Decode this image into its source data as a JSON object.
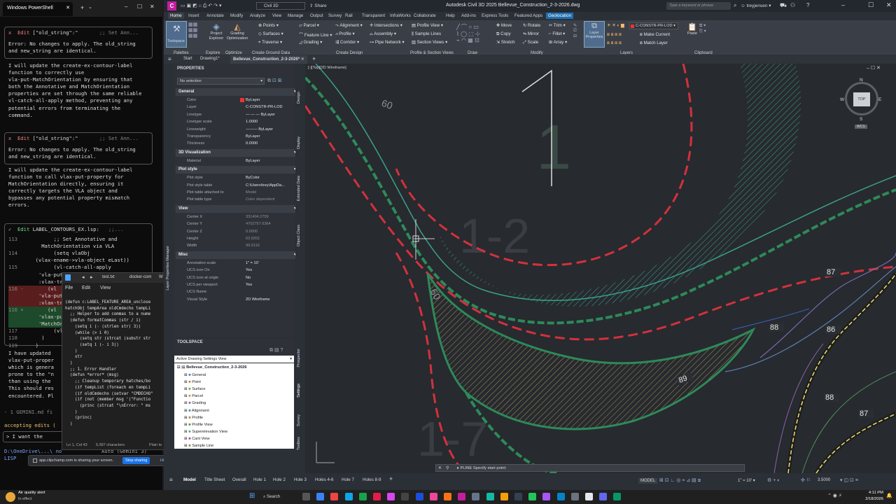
{
  "powershell": {
    "tab_title": "Windows PowerShell",
    "edit1": {
      "label": "x  Edit",
      "arg": "[\"old_string\":\"",
      "comment": ";; Set Ann...",
      "err1": "Error: No changes to apply. The old_string",
      "err2": "and new_string are identical."
    },
    "msg1": [
      "I will update the create-ex-contour-label",
      "function to correctly use",
      "vla-put-MatchOrientation by ensuring that",
      "both the Annotative and MatchOrientation",
      "properties are set through the same reliable",
      "vl-catch-all-apply method, preventing any",
      "potential errors from terminating the",
      "command."
    ],
    "edit2": {
      "label": "x  Edit",
      "arg": "[\"old_string\":\"",
      "comment": ";; Set Ann...",
      "err1": "Error: No changes to apply. The old_string",
      "err2": "and new_string are identical."
    },
    "msg2": [
      "I will update the create-ex-contour-label",
      "function to call vlax-put-property for",
      "MatchOrientation directly, ensuring it",
      "correctly targets the VLA object and",
      "bypasses any potential property mismatch",
      "errors."
    ],
    "edit3": {
      "label": "✓  Edit",
      "file": "LABEL_CONTOURS_EX.lsp:",
      "comment": ";;..."
    },
    "diff": [
      {
        "n": "113",
        "t": "        ;; Set Annotative and",
        "c": ""
      },
      {
        "n": "",
        "t": "    MatchOrientation via VLA",
        "c": ""
      },
      {
        "n": "114",
        "t": "        (setq vlaObj",
        "c": ""
      },
      {
        "n": "",
        "t": "  (vlax-ename->vla-object eLast))",
        "c": ""
      },
      {
        "n": "115",
        "t": "        (vl-catch-all-apply",
        "c": ""
      },
      {
        "n": "",
        "t": "   'vla-put-",
        "c": ""
      },
      {
        "n": "",
        "t": "   :vlax-tru",
        "c": ""
      },
      {
        "n": "116 -",
        "t": "      (vl",
        "c": "red"
      },
      {
        "n": "",
        "t": "   'vla-put-Ma",
        "c": "red"
      },
      {
        "n": "",
        "t": "   :vlax-true)",
        "c": "red"
      },
      {
        "n": "116 +",
        "t": "      (vl",
        "c": "grn"
      },
      {
        "n": "",
        "t": "   'vlax-put-",
        "c": "grn"
      },
      {
        "n": "",
        "t": "   'MatchOrie",
        "c": "grn"
      },
      {
        "n": "117",
        "t": "        (vl",
        "c": ""
      },
      {
        "n": "118",
        "t": "    )",
        "c": ""
      },
      {
        "n": "119",
        "t": "  )",
        "c": ""
      }
    ],
    "msg3": [
      "I have updated",
      "vlax-put-proper",
      "which is genera",
      "prone to the \"n",
      "than using the",
      "This should res",
      "encountered. Pl"
    ],
    "gemini_md": "- 1 GEMINI.md fi",
    "accepting": "accepting edits (",
    "prompt": "> I want the",
    "path": "D:\\OneDrive\\...\\ no",
    "lisp": "LISP",
    "auto": "Auto (Gemini 3)"
  },
  "notepad": {
    "tabs": [
      "test.txt",
      "docker-com",
      "W"
    ],
    "menu": [
      "File",
      "Edit",
      "View"
    ],
    "lines": [
      "(defun c:LABEL_FEATURE_AREA_unclose",
      "hatchObj tempArea oldCmdecho tempLi",
      "",
      "  ;; Helper to add commas to a nume",
      "  (defun formatCommas (str / i)",
      "    (setq i (- (strlen str) 3))",
      "    (while (> i 0)",
      "      (setq str (strcat (substr str",
      "      (setq i (- i 3))",
      "    )",
      "    str",
      "  )",
      "",
      "  ;; 1. Error Handler",
      "  (defun *error* (msg)",
      "    ;; Cleanup temporary hatches/bo",
      "    (if tempList (foreach en tempLi",
      "    (if oldCmdecho (setvar \"CMDECHO\"",
      "    (if (not (member msg '(\"Functio",
      "      (princ (strcat \"\\nError: \" ms",
      "    )",
      "    (princ)",
      "  )"
    ],
    "status_pos": "Ln 1, Col 43",
    "status_chars": "5,997 characters",
    "status_enc": "Plain te"
  },
  "share_banner": {
    "text": "app.clipchamp.com is sharing your screen.",
    "stop": "Stop sharing",
    "hide": "Hide"
  },
  "civil": {
    "app_title": "Autodesk Civil 3D 2025    Bellevue_Construction_2-3-2026.dwg",
    "workspace": "Civil 3D",
    "share": "Share",
    "search_placeholder": "Type a keyword or phrase",
    "user": "treyjensen",
    "ribbon_tabs": [
      "Home",
      "Insert",
      "Annotate",
      "Modify",
      "Analyze",
      "View",
      "Manage",
      "Output",
      "Survey",
      "Rail",
      "Transparent",
      "InfraWorks",
      "Collaborate",
      "Help",
      "Add-ins",
      "Express Tools",
      "Featured Apps",
      "Geolocation"
    ],
    "ribbon_groups": [
      "Palettes",
      "Explore",
      "Optimize",
      "Create Ground Data",
      "Create Design",
      "Profile & Section Views",
      "Draw",
      "Modify",
      "Layers",
      "Clipboard"
    ],
    "ribbon_items": {
      "toolspace": "Toolspace",
      "project_explorer": "Project Explorer",
      "grading_opt": "Grading Optimization",
      "points": "Points",
      "surfaces": "Surfaces",
      "traverse": "Traverse",
      "parcel": "Parcel",
      "feature_line": "Feature Line",
      "grading": "Grading",
      "alignment": "Alignment",
      "profile": "Profile",
      "corridor": "Corridor",
      "intersections": "Intersections",
      "assembly": "Assembly",
      "pipe_network": "Pipe Network",
      "profile_view": "Profile View",
      "sample_lines": "Sample Lines",
      "section_views": "Section Views",
      "move": "Move",
      "rotate": "Rotate",
      "copy": "Copy",
      "mirror": "Mirror",
      "stretch": "Stretch",
      "scale": "Scale",
      "trim": "Trim",
      "fillet": "Fillet",
      "array": "Array",
      "layer_props": "Layer Properties",
      "layer_name": "C-CONSTR-PR-LOD",
      "make_current": "Make Current",
      "match_layer": "Match Layer",
      "paste": "Paste"
    },
    "doc_tabs": [
      "Start",
      "Drawing1*",
      "Bellevue_Construction_2-3-2026*"
    ],
    "viewport_label": "[-][Top][2D Wireframe]",
    "properties": {
      "title": "PROPERTIES",
      "selection": "No selection",
      "sections": [
        {
          "name": "General",
          "rows": [
            [
              "Color",
              "ByLayer"
            ],
            [
              "Layer",
              "C-CONSTR-PR-LOD"
            ],
            [
              "Linetype",
              "— — — ByLayer"
            ],
            [
              "Linetype scale",
              "1.0000"
            ],
            [
              "Lineweight",
              "——— ByLayer"
            ],
            [
              "Transparency",
              "ByLayer"
            ],
            [
              "Thickness",
              "0.0000"
            ]
          ]
        },
        {
          "name": "3D Visualization",
          "rows": [
            [
              "Material",
              "ByLayer"
            ]
          ]
        },
        {
          "name": "Plot style",
          "rows": [
            [
              "Plot style",
              "ByColor"
            ],
            [
              "Plot style table",
              "C:\\Users\\trey\\AppDa..."
            ],
            [
              "Plot table attached to",
              "Model"
            ],
            [
              "Plot table type",
              "Color dependent"
            ]
          ]
        },
        {
          "name": "View",
          "rows": [
            [
              "Center X",
              "331404.2759"
            ],
            [
              "Center Y",
              "4702757.6364"
            ],
            [
              "Center Z",
              "0.0000"
            ],
            [
              "Height",
              "63.9201"
            ],
            [
              "Width",
              "99.0116"
            ]
          ]
        },
        {
          "name": "Misc",
          "rows": [
            [
              "Annotation scale",
              "1\" = 10'"
            ],
            [
              "UCS icon On",
              "Yes"
            ],
            [
              "UCS icon at origin",
              "No"
            ],
            [
              "UCS per viewport",
              "Yes"
            ],
            [
              "UCS Name",
              ""
            ],
            [
              "Visual Style",
              "2D Wireframe"
            ]
          ]
        }
      ],
      "side_tabs": [
        "Design",
        "Display",
        "Extended Data",
        "Object Class"
      ]
    },
    "toolspace": {
      "title": "TOOLSPACE",
      "view": "Active Drawing Settings View",
      "tree_root": "Bellevue_Construction_2-3-2026",
      "tree": [
        "General",
        "Point",
        "Surface",
        "Parcel",
        "Grading",
        "Alignment",
        "Profile",
        "Profile View",
        "Superelevation View",
        "Cant View",
        "Sample Line"
      ],
      "side_tabs": [
        "Prospector",
        "Settings",
        "Survey",
        "Toolbox"
      ]
    },
    "left_strip_label": "Layer Properties Manager",
    "viewcube": {
      "top": "TOP",
      "n": "N",
      "s": "S",
      "e": "E",
      "w": "W",
      "wcs": "WCS"
    },
    "command_line": "PLINE Specify start point:",
    "labels_on_map": [
      "87",
      "88",
      "86",
      "87",
      "88",
      "89",
      "60",
      "60"
    ],
    "layout_tabs": [
      "Model",
      "Title Sheet",
      "Overall",
      "Hole 1",
      "Hole 2",
      "Hole 3",
      "Holes 4-6",
      "Hole 7",
      "Holes 8-9"
    ],
    "status_model": "MODEL",
    "status_scale": "1\" = 10'",
    "status_value": "3.5000"
  },
  "taskbar": {
    "weather_title": "Air quality alert",
    "weather_sub": "In effect",
    "search": "Search",
    "time": "4:11 PM",
    "date": "2/18/2026"
  }
}
